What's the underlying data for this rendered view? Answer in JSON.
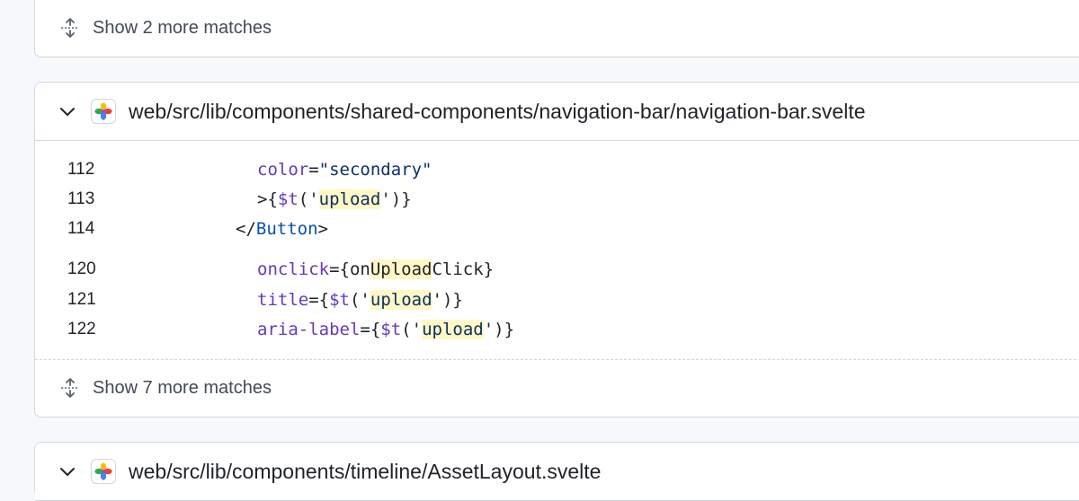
{
  "top_section": {
    "show_more_label": "Show 2 more matches"
  },
  "file_result": {
    "path": "web/src/lib/components/shared-components/navigation-bar/navigation-bar.svelte",
    "lines": [
      {
        "number": "112",
        "attr": "color",
        "eq": "=",
        "value": "\"secondary\""
      },
      {
        "number": "113",
        "prefix": ">{",
        "fn": "$t",
        "open": "('",
        "hl": "upload",
        "close": "')}"
      },
      {
        "number": "114",
        "lt": "</",
        "tag": "Button",
        "gt": ">"
      },
      {
        "number": "120",
        "attr": "onclick",
        "eq": "={on",
        "hl": "Upload",
        "rest": "Click}"
      },
      {
        "number": "121",
        "attr": "title",
        "eq": "={",
        "fn": "$t",
        "open": "('",
        "hl": "upload",
        "close": "')}"
      },
      {
        "number": "122",
        "attr": "aria-label",
        "eq": "={",
        "fn": "$t",
        "open": "('",
        "hl": "upload",
        "close": "')}"
      }
    ],
    "show_more_label": "Show 7 more matches"
  },
  "next_file": {
    "path": "web/src/lib/components/timeline/AssetLayout.svelte"
  },
  "colors": {
    "attr": "#6639ba",
    "string": "#0a3069",
    "tag": "#0550ae",
    "highlight": "#fff8c5",
    "border": "#d0d7de"
  }
}
